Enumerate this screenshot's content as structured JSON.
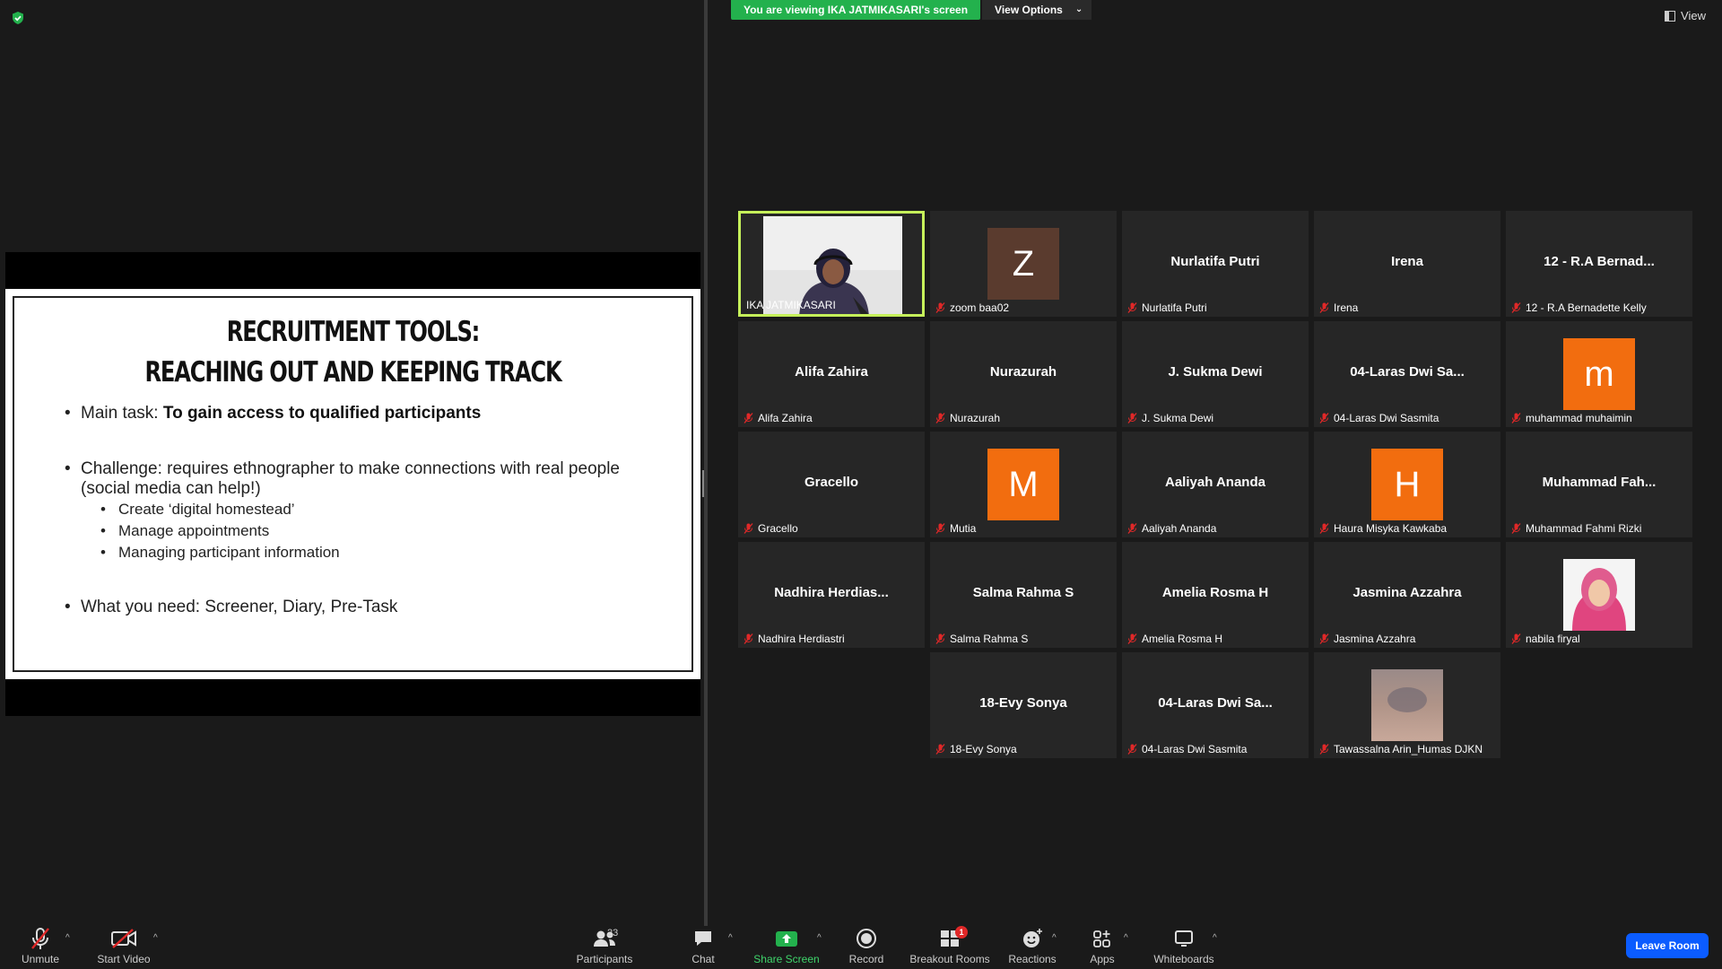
{
  "banner": {
    "viewing_text": "You are viewing IKA JATMIKASARI's screen",
    "view_options_label": "View Options"
  },
  "view_button_label": "View",
  "slide": {
    "title_line1": "RECRUITMENT TOOLS:",
    "title_line2": "REACHING OUT AND KEEPING TRACK",
    "b1_prefix": "Main task: ",
    "b1_bold": "To gain access to qualified participants",
    "b2_line1": "Challenge: requires ethnographer to make connections with real people",
    "b2_line2": "(social media can help!)",
    "sub1": "Create ‘digital homestead’",
    "sub2": "Manage appointments",
    "sub3": "Managing participant information",
    "b3": "What you need: Screener, Diary, Pre-Task"
  },
  "participants": [
    {
      "center": "",
      "footer": "IKA JATMIKASARI",
      "kind": "video"
    },
    {
      "center": "",
      "footer": "zoom baa02",
      "kind": "avatar",
      "letter": "Z",
      "color": "#5a3b2e"
    },
    {
      "center": "Nurlatifa Putri",
      "footer": "Nurlatifa Putri",
      "kind": "name"
    },
    {
      "center": "Irena",
      "footer": "Irena",
      "kind": "name"
    },
    {
      "center": "12 - R.A Bernad...",
      "footer": "12 - R.A Bernadette Kelly",
      "kind": "name"
    },
    {
      "center": "Alifa Zahira",
      "footer": "Alifa Zahira",
      "kind": "name"
    },
    {
      "center": "Nurazurah",
      "footer": "Nurazurah",
      "kind": "name"
    },
    {
      "center": "J. Sukma Dewi",
      "footer": "J. Sukma Dewi",
      "kind": "name"
    },
    {
      "center": "04-Laras Dwi Sa...",
      "footer": "04-Laras Dwi Sasmita",
      "kind": "name"
    },
    {
      "center": "",
      "footer": "muhammad muhaimin",
      "kind": "avatar",
      "letter": "m",
      "color": "#f26d0f"
    },
    {
      "center": "Gracello",
      "footer": "Gracello",
      "kind": "name"
    },
    {
      "center": "",
      "footer": "Mutia",
      "kind": "avatar",
      "letter": "M",
      "color": "#f26d0f"
    },
    {
      "center": "Aaliyah Ananda",
      "footer": "Aaliyah Ananda",
      "kind": "name"
    },
    {
      "center": "",
      "footer": "Haura Misyka Kawkaba",
      "kind": "avatar",
      "letter": "H",
      "color": "#f26d0f"
    },
    {
      "center": "Muhammad Fah...",
      "footer": "Muhammad Fahmi Rizki",
      "kind": "name"
    },
    {
      "center": "Nadhira Herdias...",
      "footer": "Nadhira Herdiastri",
      "kind": "name"
    },
    {
      "center": "Salma Rahma S",
      "footer": "Salma Rahma S",
      "kind": "name"
    },
    {
      "center": "Amelia Rosma H",
      "footer": "Amelia Rosma H",
      "kind": "name"
    },
    {
      "center": "Jasmina Azzahra",
      "footer": "Jasmina Azzahra",
      "kind": "name"
    },
    {
      "center": "",
      "footer": "nabila firyal",
      "kind": "photo-hijab"
    },
    {
      "center": "18-Evy Sonya",
      "footer": "18-Evy Sonya",
      "kind": "name"
    },
    {
      "center": "04-Laras Dwi Sa...",
      "footer": "04-Laras Dwi Sasmita",
      "kind": "name"
    },
    {
      "center": "",
      "footer": "Tawassalna Arin_Humas DJKN",
      "kind": "photo-blur"
    }
  ],
  "toolbar": {
    "unmute": "Unmute",
    "start_video": "Start Video",
    "participants": "Participants",
    "participants_count": "23",
    "chat": "Chat",
    "share_screen": "Share Screen",
    "record": "Record",
    "breakout_rooms": "Breakout Rooms",
    "breakout_badge": "1",
    "reactions": "Reactions",
    "apps": "Apps",
    "whiteboards": "Whiteboards",
    "leave_room": "Leave Room"
  }
}
